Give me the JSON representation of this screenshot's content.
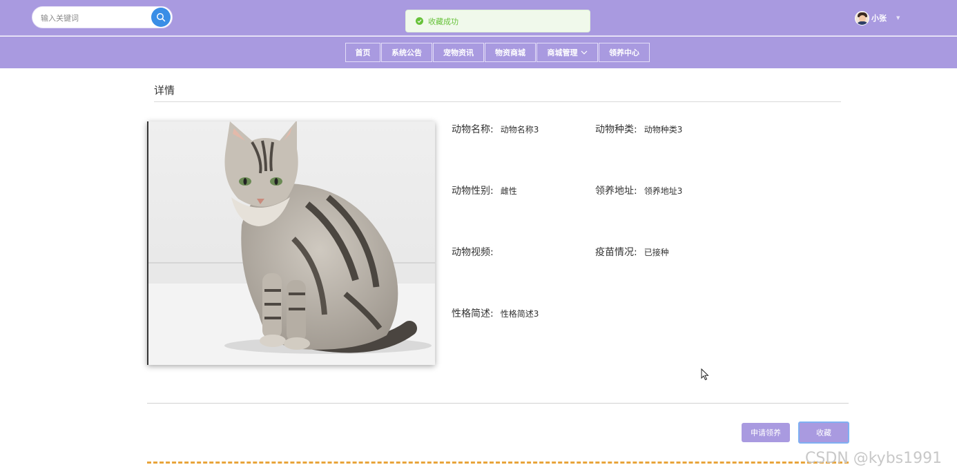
{
  "header": {
    "search": {
      "placeholder": "输入关键词",
      "value": ""
    },
    "toast": {
      "message": "收藏成功"
    },
    "user": {
      "name": "小张"
    }
  },
  "nav": {
    "items": [
      {
        "label": "首页"
      },
      {
        "label": "系统公告"
      },
      {
        "label": "宠物资讯"
      },
      {
        "label": "物资商城"
      },
      {
        "label": "商城管理"
      },
      {
        "label": "领养中心"
      }
    ]
  },
  "detail": {
    "title": "详情",
    "fields": {
      "name": {
        "label": "动物名称:",
        "value": "动物名称3"
      },
      "species": {
        "label": "动物种类:",
        "value": "动物种类3"
      },
      "gender": {
        "label": "动物性别:",
        "value": "雌性"
      },
      "address": {
        "label": "领养地址:",
        "value": "领养地址3"
      },
      "video": {
        "label": "动物视频:",
        "value": ""
      },
      "vaccine": {
        "label": "疫苗情况:",
        "value": "已接种"
      },
      "personality": {
        "label": "性格简述:",
        "value": "性格简述3"
      }
    },
    "actions": {
      "apply": "申请领养",
      "favorite": "收藏"
    }
  },
  "watermark": "CSDN @kybs1991",
  "colors": {
    "theme": "#a99ae0",
    "success": "#67c23a",
    "search_button": "#3a8ee6",
    "divider_dashed": "#e8a43a"
  }
}
